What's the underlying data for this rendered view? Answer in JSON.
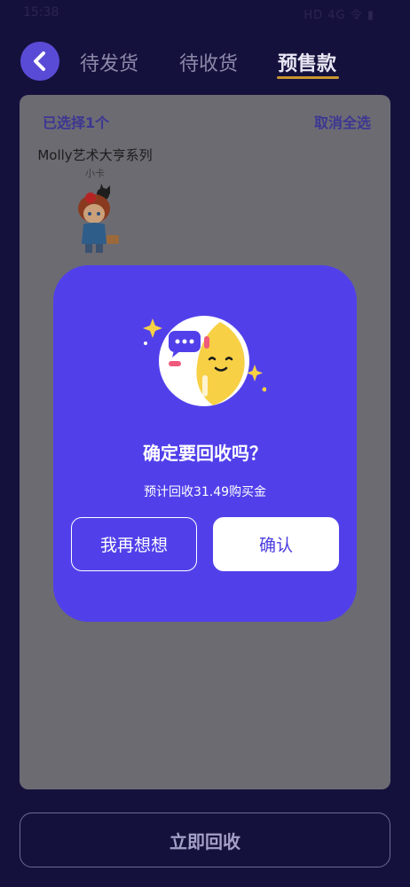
{
  "status_bar": {
    "time": "15:38",
    "indicators": "HD 4G 令 ▮"
  },
  "header": {
    "tabs": [
      {
        "label": "待发货",
        "active": false
      },
      {
        "label": "待收货",
        "active": false
      },
      {
        "label": "预售款",
        "active": true
      }
    ]
  },
  "card": {
    "selected_text": "已选择1个",
    "deselect_text": "取消全选",
    "product": {
      "name": "Molly艺术大亨系列",
      "subtitle": "小卡"
    }
  },
  "dialog": {
    "title": "确定要回收吗？",
    "description": "预计回收31.49购买金",
    "cancel_label": "我再想想",
    "confirm_label": "确认"
  },
  "footer": {
    "recycle_label": "立即回收"
  },
  "colors": {
    "background": "#15113d",
    "accent": "#5140ea",
    "tab_underline": "#c9962f",
    "card": "#6c6b72"
  }
}
